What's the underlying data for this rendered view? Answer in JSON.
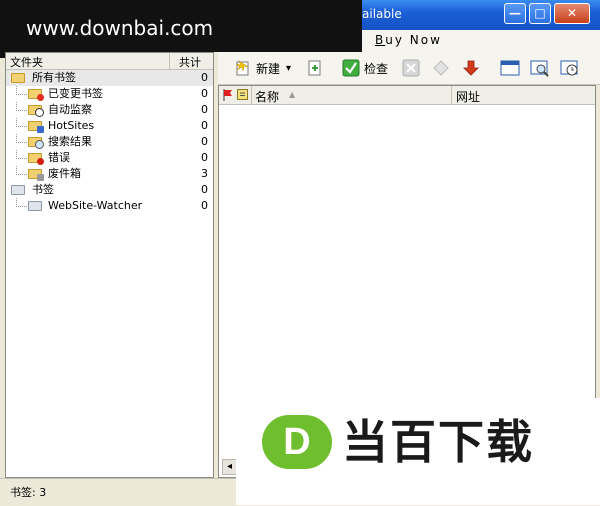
{
  "watermark": {
    "text": "www.downbai.com"
  },
  "window": {
    "title_fragment": "ailable",
    "minimize_glyph": "—",
    "maximize_glyph": "□",
    "close_glyph": "✕"
  },
  "menu": {
    "buy_now_prefix": "B",
    "buy_now_rest": "uy Now"
  },
  "toolbar": {
    "new_label": "新建",
    "new_dropdown": "▾",
    "check_label": "检查"
  },
  "folders": {
    "col_folder": "文件夹",
    "col_total": "共计",
    "items": [
      {
        "label": "所有书签",
        "count": "0"
      },
      {
        "label": "已变更书签",
        "count": "0"
      },
      {
        "label": "自动监察",
        "count": "0"
      },
      {
        "label": "HotSites",
        "count": "0"
      },
      {
        "label": "搜索结果",
        "count": "0"
      },
      {
        "label": "错误",
        "count": "0"
      },
      {
        "label": "废件箱",
        "count": "3"
      },
      {
        "label": "书签",
        "count": "0"
      },
      {
        "label": "WebSite-Watcher",
        "count": "0"
      }
    ]
  },
  "list": {
    "col_name": "名称",
    "col_url": "网址",
    "sort_glyph": "▲"
  },
  "scrollbar": {
    "left_arrow": "◂"
  },
  "status": {
    "bookmarks": "书签: 3"
  },
  "brand": {
    "logo_letter": "D",
    "text": "当百下载"
  },
  "colors": {
    "accent_green": "#6fbe2d",
    "brand_dark": "#1a1a1a",
    "titlebar_blue": "#1b5fd6"
  }
}
